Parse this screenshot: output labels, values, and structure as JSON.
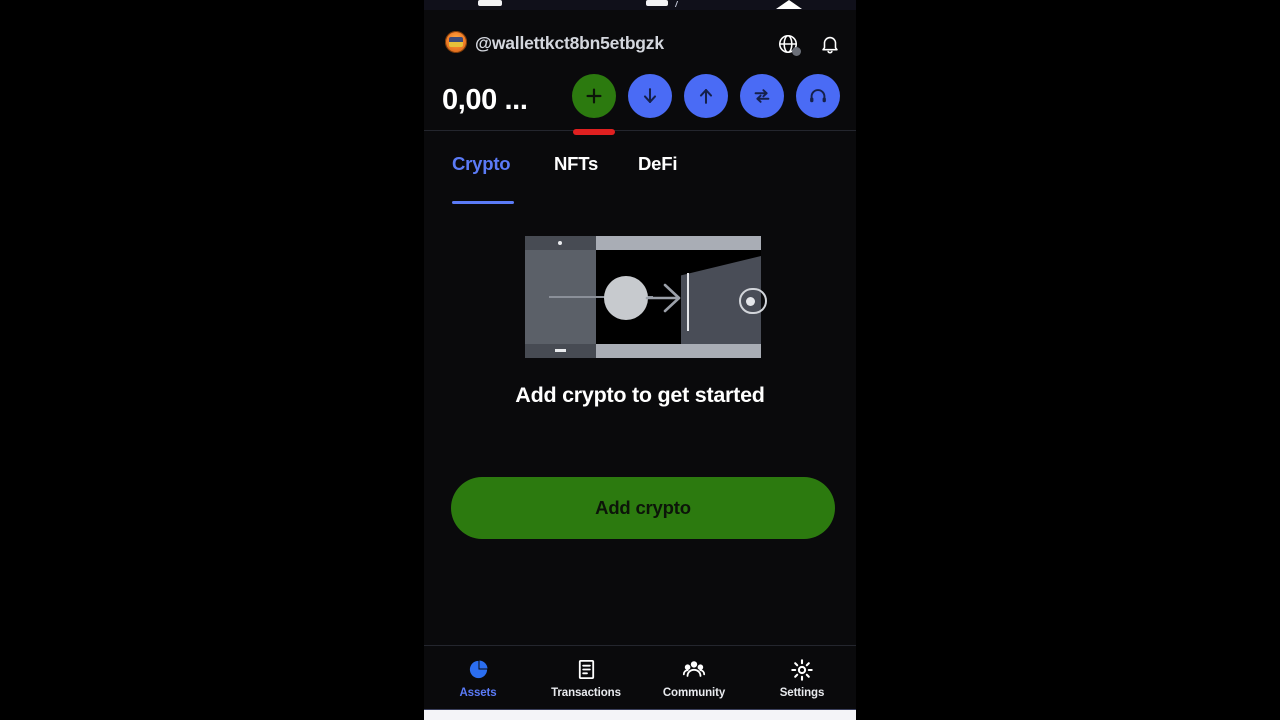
{
  "app": {
    "background_color": "#000000",
    "screen_color": "#0a0a0c",
    "accent_blue": "#5b7bf7",
    "accent_green": "#2c7a0f",
    "highlight_red": "#e02020"
  },
  "header": {
    "avatar_icon": "wallet-avatar-icon",
    "username": "@wallettkct8bn5etbgzk",
    "globe_icon": "globe-icon",
    "globe_badge": "status-dot",
    "bell_icon": "bell-icon",
    "balance": "0,00 ...",
    "actions": [
      {
        "name": "add",
        "icon": "plus-icon",
        "color": "#2c7a0f",
        "highlighted": true
      },
      {
        "name": "receive",
        "icon": "arrow-down-icon",
        "color": "#4a6bf5",
        "highlighted": false
      },
      {
        "name": "send",
        "icon": "arrow-up-icon",
        "color": "#4a6bf5",
        "highlighted": false
      },
      {
        "name": "swap",
        "icon": "swap-icon",
        "color": "#4a6bf5",
        "highlighted": false
      },
      {
        "name": "support",
        "icon": "headset-icon",
        "color": "#4a6bf5",
        "highlighted": false
      }
    ]
  },
  "tabs": [
    {
      "label": "Crypto",
      "active": true
    },
    {
      "label": "NFTs",
      "active": false
    },
    {
      "label": "DeFi",
      "active": false
    }
  ],
  "empty_state": {
    "illustration": "coin-into-wallet-illustration",
    "title": "Add crypto to get started",
    "cta_label": "Add crypto"
  },
  "bottom_nav": [
    {
      "label": "Assets",
      "icon": "pie-chart-icon",
      "active": true
    },
    {
      "label": "Transactions",
      "icon": "document-icon",
      "active": false
    },
    {
      "label": "Community",
      "icon": "people-icon",
      "active": false
    },
    {
      "label": "Settings",
      "icon": "gear-icon",
      "active": false
    }
  ]
}
